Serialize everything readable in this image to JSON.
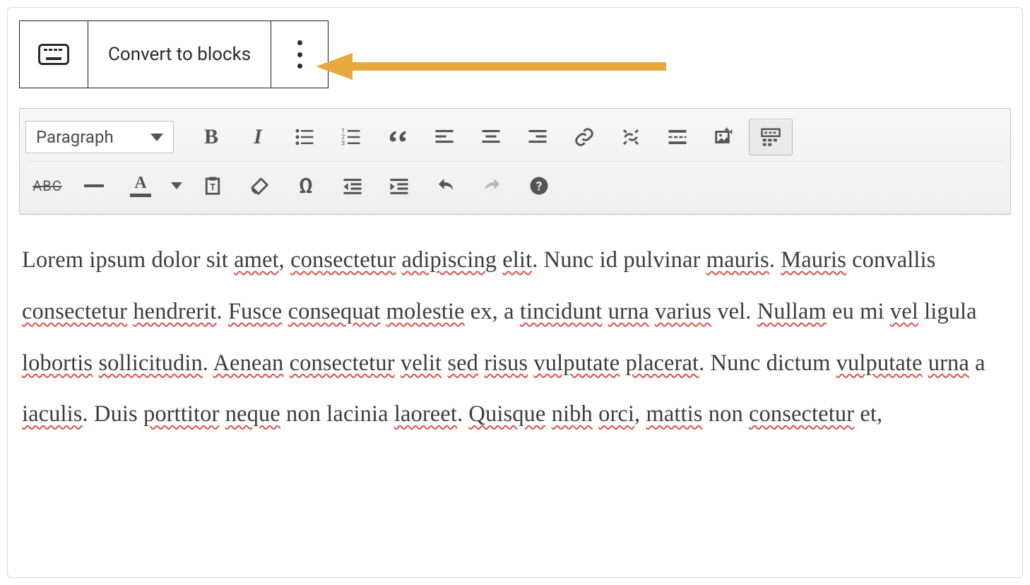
{
  "block_toolbar": {
    "convert_label": "Convert to blocks"
  },
  "tinymce": {
    "format_select": "Paragraph",
    "row1": {
      "bold": "B",
      "italic": "I"
    },
    "row2": {
      "strikethrough": "ABC",
      "textcolor": "A",
      "specialchar": "Ω",
      "help": "?"
    }
  },
  "content": {
    "segments": [
      {
        "t": "Lorem ipsum dolor sit ",
        "s": false
      },
      {
        "t": "amet",
        "s": true
      },
      {
        "t": ", ",
        "s": false
      },
      {
        "t": "consectetur",
        "s": true
      },
      {
        "t": " ",
        "s": false
      },
      {
        "t": "adipiscing",
        "s": true
      },
      {
        "t": " ",
        "s": false
      },
      {
        "t": "elit",
        "s": true
      },
      {
        "t": ". Nunc id pulvinar ",
        "s": false
      },
      {
        "t": "mauris",
        "s": true
      },
      {
        "t": ". ",
        "s": false
      },
      {
        "t": "Mauris",
        "s": true
      },
      {
        "t": " convallis ",
        "s": false
      },
      {
        "t": "consectetur",
        "s": true
      },
      {
        "t": " ",
        "s": false
      },
      {
        "t": "hendrerit",
        "s": true
      },
      {
        "t": ". ",
        "s": false
      },
      {
        "t": "Fusce",
        "s": true
      },
      {
        "t": " ",
        "s": false
      },
      {
        "t": "consequat",
        "s": true
      },
      {
        "t": " ",
        "s": false
      },
      {
        "t": "molestie",
        "s": true
      },
      {
        "t": " ex, a ",
        "s": false
      },
      {
        "t": "tincidunt",
        "s": true
      },
      {
        "t": " ",
        "s": false
      },
      {
        "t": "urna",
        "s": true
      },
      {
        "t": " ",
        "s": false
      },
      {
        "t": "varius",
        "s": true
      },
      {
        "t": " vel. ",
        "s": false
      },
      {
        "t": "Nullam",
        "s": true
      },
      {
        "t": " eu mi ",
        "s": false
      },
      {
        "t": "vel",
        "s": true
      },
      {
        "t": " ligula ",
        "s": false
      },
      {
        "t": "lobortis",
        "s": true
      },
      {
        "t": " ",
        "s": false
      },
      {
        "t": "sollicitudin",
        "s": true
      },
      {
        "t": ". ",
        "s": false
      },
      {
        "t": "Aenean",
        "s": true
      },
      {
        "t": " ",
        "s": false
      },
      {
        "t": "consectetur",
        "s": true
      },
      {
        "t": " ",
        "s": false
      },
      {
        "t": "velit",
        "s": true
      },
      {
        "t": " ",
        "s": false
      },
      {
        "t": "sed",
        "s": true
      },
      {
        "t": " ",
        "s": false
      },
      {
        "t": "risus",
        "s": true
      },
      {
        "t": " ",
        "s": false
      },
      {
        "t": "vulputate",
        "s": true
      },
      {
        "t": " ",
        "s": false
      },
      {
        "t": "placerat",
        "s": true
      },
      {
        "t": ". Nunc dictum ",
        "s": false
      },
      {
        "t": "vulputate",
        "s": true
      },
      {
        "t": " ",
        "s": false
      },
      {
        "t": "urna",
        "s": true
      },
      {
        "t": " a ",
        "s": false
      },
      {
        "t": "iaculis",
        "s": true
      },
      {
        "t": ". Duis ",
        "s": false
      },
      {
        "t": "porttitor",
        "s": true
      },
      {
        "t": " ",
        "s": false
      },
      {
        "t": "neque",
        "s": true
      },
      {
        "t": " non lacinia ",
        "s": false
      },
      {
        "t": "laoreet",
        "s": true
      },
      {
        "t": ". ",
        "s": false
      },
      {
        "t": "Quisque",
        "s": true
      },
      {
        "t": " ",
        "s": false
      },
      {
        "t": "nibh",
        "s": true
      },
      {
        "t": " ",
        "s": false
      },
      {
        "t": "orci",
        "s": true
      },
      {
        "t": ", ",
        "s": false
      },
      {
        "t": "mattis",
        "s": true
      },
      {
        "t": " non ",
        "s": false
      },
      {
        "t": "consectetur",
        "s": true
      },
      {
        "t": " et,",
        "s": false
      }
    ]
  },
  "annotation": {
    "arrow_color": "#e6a93e"
  }
}
